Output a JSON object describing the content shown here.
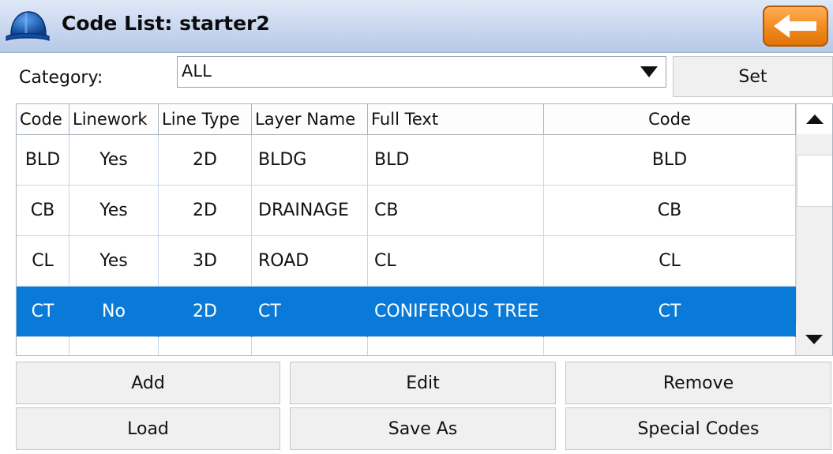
{
  "window": {
    "title": "Code List: starter2",
    "app_icon": "hardhat-icon",
    "back_icon": "back-arrow-icon",
    "back_button_color": "#f08a1e"
  },
  "category": {
    "label": "Category:",
    "value": "ALL",
    "set_label": "Set"
  },
  "table": {
    "columns": [
      "Code",
      "Linework",
      "Line Type",
      "Layer Name",
      "Full Text",
      "Code"
    ],
    "rows": [
      {
        "code": "BLD",
        "linework": "Yes",
        "line_type": "2D",
        "layer": "BLDG",
        "full_text": "BLD",
        "code2": "BLD"
      },
      {
        "code": "CB",
        "linework": "Yes",
        "line_type": "2D",
        "layer": "DRAINAGE",
        "full_text": "CB",
        "code2": "CB"
      },
      {
        "code": "CL",
        "linework": "Yes",
        "line_type": "3D",
        "layer": "ROAD",
        "full_text": "CL",
        "code2": "CL"
      },
      {
        "code": "CT",
        "linework": "No",
        "line_type": "2D",
        "layer": "CT",
        "full_text": "CONIFEROUS TREE",
        "code2": "CT"
      }
    ],
    "selected_row": 3,
    "selection_color": "#0a7ad8"
  },
  "buttons": {
    "add": "Add",
    "edit": "Edit",
    "remove": "Remove",
    "load": "Load",
    "save_as": "Save As",
    "special_codes": "Special Codes"
  }
}
